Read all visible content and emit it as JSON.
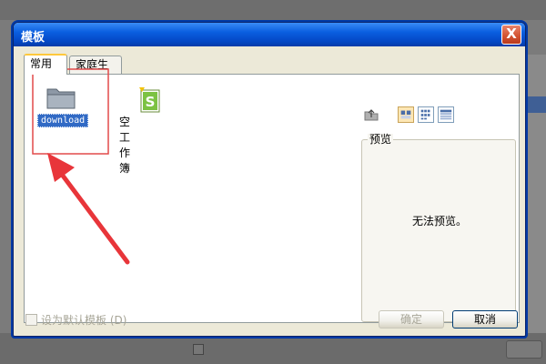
{
  "dialog": {
    "title": "模板",
    "close_label": "X"
  },
  "tabs": [
    {
      "label": "常用",
      "active": true
    },
    {
      "label": "家庭生活",
      "active": false
    }
  ],
  "items": [
    {
      "label": "download",
      "icon": "folder-icon",
      "selected": true
    },
    {
      "label": "空工作簿",
      "icon": "spreadsheet-icon",
      "selected": false
    }
  ],
  "view_buttons": [
    "up-folder-icon",
    "large-icons-icon",
    "list-icon",
    "details-icon"
  ],
  "preview": {
    "title": "预览",
    "message": "无法预览。"
  },
  "footer": {
    "checkbox_label": "设为默认模板 (D)",
    "ok_label": "确定",
    "cancel_label": "取消"
  },
  "colors": {
    "titlebar": "#0a5ee0",
    "selection": "#316ac5",
    "annotation": "#e24a4a"
  }
}
